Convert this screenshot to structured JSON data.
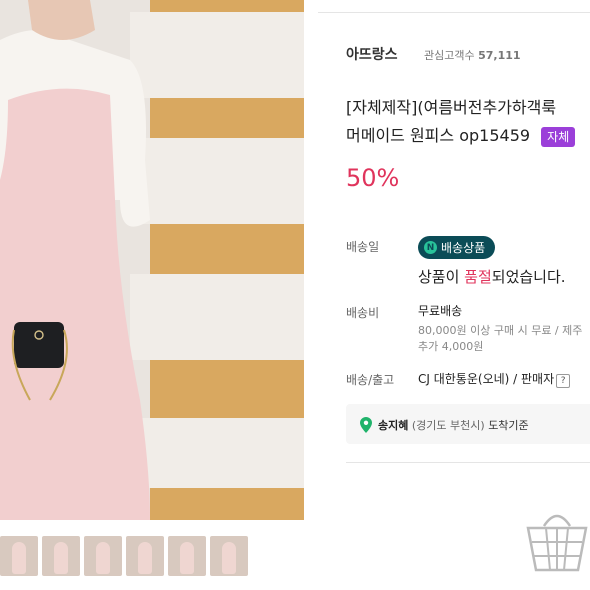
{
  "store": {
    "name": "아뜨랑스",
    "fans_label": "관심고객수",
    "fans_count": "57,111"
  },
  "product": {
    "title_line1": "[자체제작](여름버전추가하객룩",
    "title_line2": "머메이드 원피스 op15459",
    "badge": "자체",
    "discount": "50%"
  },
  "shipping": {
    "date_label": "배송일",
    "pill_icon": "N",
    "pill_text": "배송상품",
    "soldout_prefix": "상품이 ",
    "soldout_red": "품절",
    "soldout_suffix": "되었습니다.",
    "fee_label": "배송비",
    "fee_value": "무료배송",
    "cond_line1": "80,000원 이상 구매 시 무료 / 제주",
    "cond_line2": "추가 4,000원",
    "release_label": "배송/출고",
    "courier": "CJ 대한통운(오네) / 판매자",
    "help": "?"
  },
  "location": {
    "name": "송지혜",
    "region": "(경기도 부천시)",
    "suffix": "도착기준"
  },
  "thumbnails_count": 6,
  "colors": {
    "accent_red": "#e0345c",
    "badge_purple": "#9b3fd9",
    "pill_teal": "#0b4c57",
    "naver_green": "#29c39a"
  },
  "icons": {
    "location": "location-pin-icon",
    "basket": "basket-icon"
  }
}
